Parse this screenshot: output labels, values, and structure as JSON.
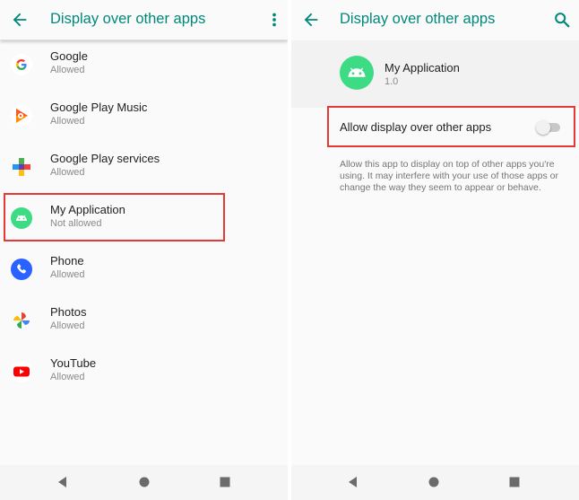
{
  "colors": {
    "accent": "#00897b",
    "highlight_border": "#e53935",
    "android_green": "#3ddc84"
  },
  "left": {
    "title": "Display over other apps",
    "back_icon": "arrow-back-icon",
    "menu_icon": "more-vert-icon",
    "apps": [
      {
        "name": "Google",
        "status": "Allowed",
        "icon": "google-icon"
      },
      {
        "name": "Google Play Music",
        "status": "Allowed",
        "icon": "play-music-icon"
      },
      {
        "name": "Google Play services",
        "status": "Allowed",
        "icon": "play-services-icon"
      },
      {
        "name": "My Application",
        "status": "Not allowed",
        "icon": "android-icon"
      },
      {
        "name": "Phone",
        "status": "Allowed",
        "icon": "phone-icon"
      },
      {
        "name": "Photos",
        "status": "Allowed",
        "icon": "photos-icon"
      },
      {
        "name": "YouTube",
        "status": "Allowed",
        "icon": "youtube-icon"
      }
    ]
  },
  "right": {
    "title": "Display over other apps",
    "back_icon": "arrow-back-icon",
    "search_icon": "search-icon",
    "app": {
      "name": "My Application",
      "version": "1.0",
      "icon": "android-icon"
    },
    "toggle": {
      "label": "Allow display over other apps",
      "checked": false
    },
    "description": "Allow this app to display on top of other apps you're using. It may interfere with your use of those apps or change the way they seem to appear or behave."
  },
  "navbar": {
    "icons": [
      "back-triangle-icon",
      "home-circle-icon",
      "recents-square-icon"
    ]
  }
}
